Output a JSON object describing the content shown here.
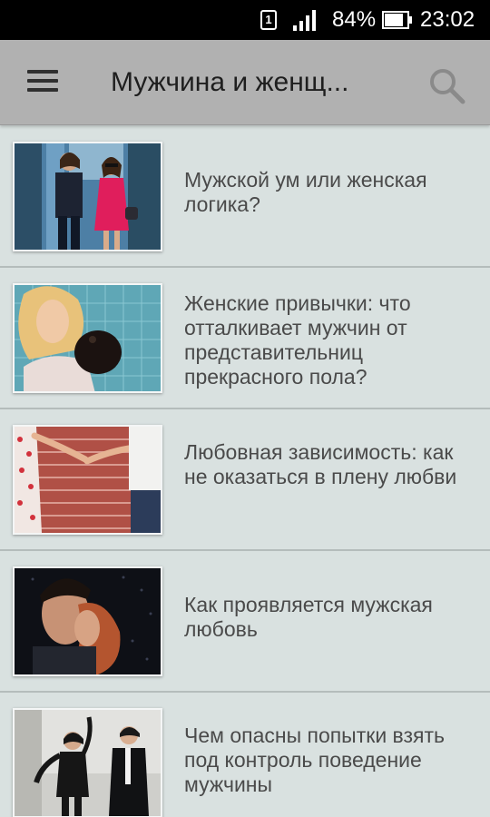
{
  "status_bar": {
    "sim_slot": "1",
    "battery_percent": "84%",
    "clock": "23:02"
  },
  "app_bar": {
    "title": "Мужчина и женщ...",
    "menu_icon": "hamburger-menu-icon",
    "search_icon": "search-icon"
  },
  "articles": [
    {
      "title": "Мужской ум или женская логика?"
    },
    {
      "title": "Женские привычки: что отталкивает мужчин от представительниц прекрасного пола?"
    },
    {
      "title": "Любовная зависимость: как не оказаться в плену любви"
    },
    {
      "title": "Как проявляется мужская любовь"
    },
    {
      "title": "Чем опасны попытки взять под контроль поведение мужчины"
    }
  ]
}
